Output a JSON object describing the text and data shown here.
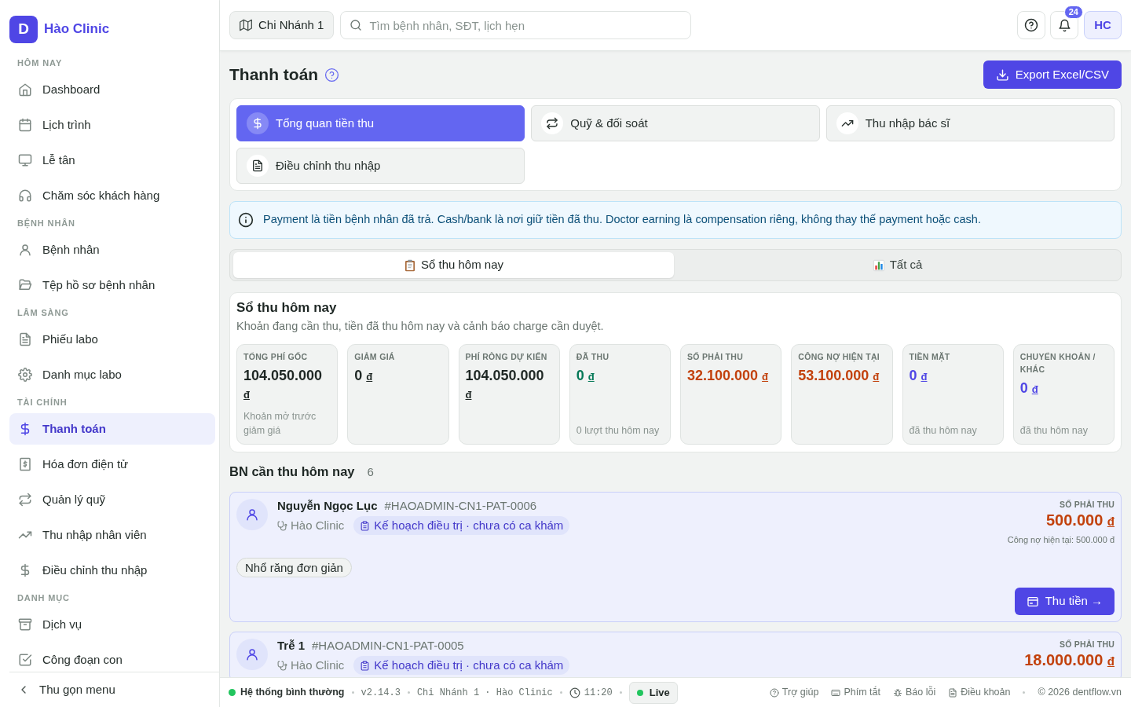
{
  "sidebar": {
    "logo": "D",
    "brand": "Hào Clinic",
    "groups": [
      {
        "heading": "HÔM NAY",
        "items": [
          {
            "label": "Dashboard",
            "selected": false
          },
          {
            "label": "Lịch trình",
            "selected": false
          },
          {
            "label": "Lễ tân",
            "selected": false
          },
          {
            "label": "Chăm sóc khách hàng",
            "selected": false
          }
        ]
      },
      {
        "heading": "BỆNH NHÂN",
        "items": [
          {
            "label": "Bệnh nhân",
            "selected": false
          },
          {
            "label": "Tệp hồ sơ bệnh nhân",
            "selected": false
          }
        ]
      },
      {
        "heading": "LÂM SÀNG",
        "items": [
          {
            "label": "Phiếu labo",
            "selected": false
          },
          {
            "label": "Danh mục labo",
            "selected": false
          }
        ]
      },
      {
        "heading": "TÀI CHÍNH",
        "items": [
          {
            "label": "Thanh toán",
            "selected": true
          },
          {
            "label": "Hóa đơn điện tử",
            "selected": false
          },
          {
            "label": "Quản lý quỹ",
            "selected": false
          },
          {
            "label": "Thu nhập nhân viên",
            "selected": false
          },
          {
            "label": "Điều chỉnh thu nhập",
            "selected": false
          }
        ]
      },
      {
        "heading": "DANH MỤC",
        "items": [
          {
            "label": "Dịch vụ",
            "selected": false
          },
          {
            "label": "Công đoạn con",
            "selected": false
          }
        ]
      }
    ],
    "collapse": "Thu gọn menu"
  },
  "topbar": {
    "branch": "Chi Nhánh 1",
    "search": {
      "placeholder": "Tìm bệnh nhân, SĐT, lịch hẹn"
    },
    "notifications": "24",
    "avatar": "HC"
  },
  "header": {
    "title": "Thanh toán",
    "export": "Export Excel/CSV"
  },
  "tabs": [
    {
      "label": "Tổng quan tiền thu",
      "selected": true
    },
    {
      "label": "Quỹ & đối soát",
      "selected": false
    },
    {
      "label": "Thu nhập bác sĩ",
      "selected": false
    },
    {
      "label": "Điều chỉnh thu nhập",
      "selected": false
    }
  ],
  "notice": "Payment là tiền bệnh nhân đã trả. Cash/bank là nơi giữ tiền đã thu. Doctor earning là compensation riêng, không thay thế payment hoặc cash.",
  "views": [
    {
      "label": "Sổ thu hôm nay",
      "selected": true
    },
    {
      "label": "Tất cả",
      "selected": false
    }
  ],
  "ledger": {
    "title": "Sổ thu hôm nay",
    "subtitle": "Khoản đang cần thu, tiền đã thu hôm nay và cảnh báo charge cần duyệt.",
    "stats": [
      {
        "label": "TỔNG PHÍ GỐC",
        "amount": "104.050.000",
        "currency": "đ",
        "color": "#1e2724",
        "note": "Khoản mở trước giảm giá"
      },
      {
        "label": "GIẢM GIÁ",
        "amount": "0",
        "currency": "đ",
        "color": "#1e2724"
      },
      {
        "label": "PHÍ RÒNG DỰ KIẾN",
        "amount": "104.050.000",
        "currency": "đ",
        "color": "#1e2724"
      },
      {
        "label": "ĐÃ THU",
        "amount": "0",
        "currency": "đ",
        "color": "#047857",
        "note": "0 lượt thu hôm nay"
      },
      {
        "label": "SỐ PHẢI THU",
        "amount": "32.100.000",
        "currency": "đ",
        "color": "#c2410c"
      },
      {
        "label": "CÔNG NỢ HIỆN TẠI",
        "amount": "53.100.000",
        "currency": "đ",
        "color": "#c2410c"
      },
      {
        "label": "TIỀN MẶT",
        "amount": "0",
        "currency": "đ",
        "color": "#4f46e5",
        "note": "đã thu hôm nay"
      },
      {
        "label": "CHUYỂN KHOẢN / KHÁC",
        "amount": "0",
        "currency": "đ",
        "color": "#4f46e5",
        "note": "đã thu hôm nay"
      }
    ]
  },
  "due": {
    "title": "BN cần thu hôm nay",
    "count": "6",
    "patients": [
      {
        "name": "Nguyễn Ngọc Lục",
        "code": "#HAOADMIN-CN1-PAT-0006",
        "clinic": "Hào Clinic",
        "plan": "Kế hoạch điều trị · chưa có ca khám",
        "due_label": "SỐ PHẢI THU",
        "due_amount": "500.000",
        "currency": "đ",
        "debt": "Công nợ hiện tại: 500.000 đ",
        "services": [
          "Nhổ răng đơn giản"
        ],
        "action": "Thu tiền →"
      },
      {
        "name": "Trễ 1",
        "code": "#HAOADMIN-CN1-PAT-0005",
        "clinic": "Hào Clinic",
        "plan": "Kế hoạch điều trị · chưa có ca khám",
        "due_label": "SỐ PHẢI THU",
        "due_amount": "18.000.000",
        "currency": "đ"
      }
    ]
  },
  "status_bar": {
    "status": "Hệ thống bình thường",
    "version": "v2.14.3",
    "location": "Chi Nhánh 1 · Hào Clinic",
    "time": "11:20",
    "live": "Live",
    "links": [
      "Trợ giúp",
      "Phím tắt",
      "Báo lỗi",
      "Điều khoản"
    ],
    "copyright": "© 2026 dentflow.vn"
  }
}
